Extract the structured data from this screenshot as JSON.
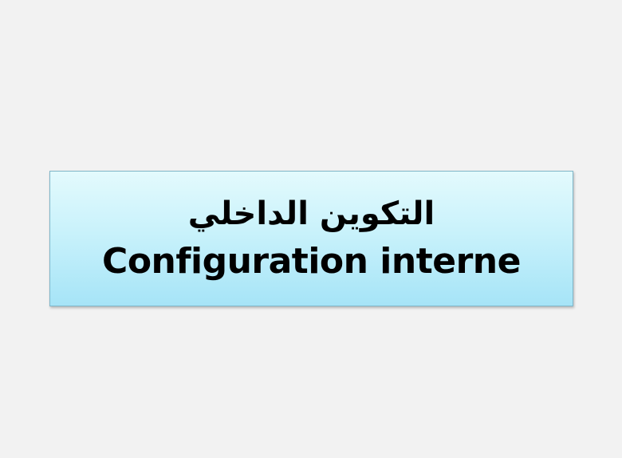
{
  "slide": {
    "title_arabic": "التكوين الداخلي",
    "title_latin": "Configuration interne"
  },
  "colors": {
    "background": "#f2f2f2",
    "box_fill_top": "#e3fafd",
    "box_fill_bottom": "#a6e4f7",
    "box_border": "#7fb6c9",
    "text": "#000000"
  }
}
